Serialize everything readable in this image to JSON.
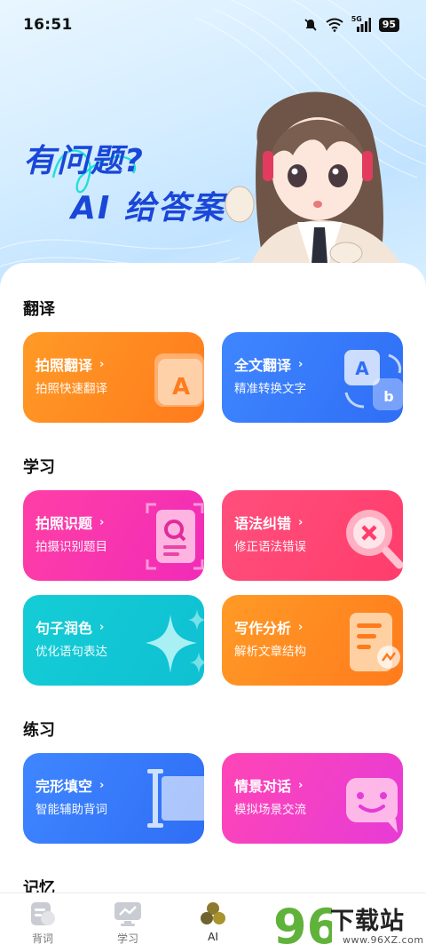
{
  "status_bar": {
    "time": "16:51",
    "network": "5G",
    "battery": "95",
    "icons": [
      "mute-icon",
      "wifi-icon",
      "signal-icon",
      "battery-icon"
    ]
  },
  "hero": {
    "line1": "有问题?",
    "line2": "AI 给答案"
  },
  "sections": {
    "translate": {
      "title": "翻译",
      "cards": [
        {
          "title": "拍照翻译",
          "subtitle": "拍照快速翻译",
          "chevron": "›",
          "color": "#ff8a20"
        },
        {
          "title": "全文翻译",
          "subtitle": "精准转换文字",
          "chevron": "›",
          "color": "#3a7cff"
        }
      ]
    },
    "study": {
      "title": "学习",
      "cards": [
        {
          "title": "拍照识题",
          "subtitle": "拍摄识别题目",
          "chevron": "›",
          "color": "#f832b0"
        },
        {
          "title": "语法纠错",
          "subtitle": "修正语法错误",
          "chevron": "›",
          "color": "#ff4775"
        },
        {
          "title": "句子润色",
          "subtitle": "优化语句表达",
          "chevron": "›",
          "color": "#12c6d4"
        },
        {
          "title": "写作分析",
          "subtitle": "解析文章结构",
          "chevron": "›",
          "color": "#ff8420"
        }
      ]
    },
    "practice": {
      "title": "练习",
      "cards": [
        {
          "title": "完形填空",
          "subtitle": "智能辅助背词",
          "chevron": "›",
          "color": "#3a7cff"
        },
        {
          "title": "情景对话",
          "subtitle": "模拟场景交流",
          "chevron": "›",
          "color": "#f03fc8"
        }
      ]
    },
    "memory": {
      "title": "记忆"
    }
  },
  "tabbar": {
    "tabs": [
      {
        "label": "背词",
        "icon": "vocab-icon"
      },
      {
        "label": "学习",
        "icon": "monitor-icon"
      },
      {
        "label": "AI",
        "icon": "ai-icon",
        "active": true
      }
    ]
  },
  "watermark": {
    "number": "96",
    "brand": "下载站",
    "url": "www.96XZ.com"
  }
}
